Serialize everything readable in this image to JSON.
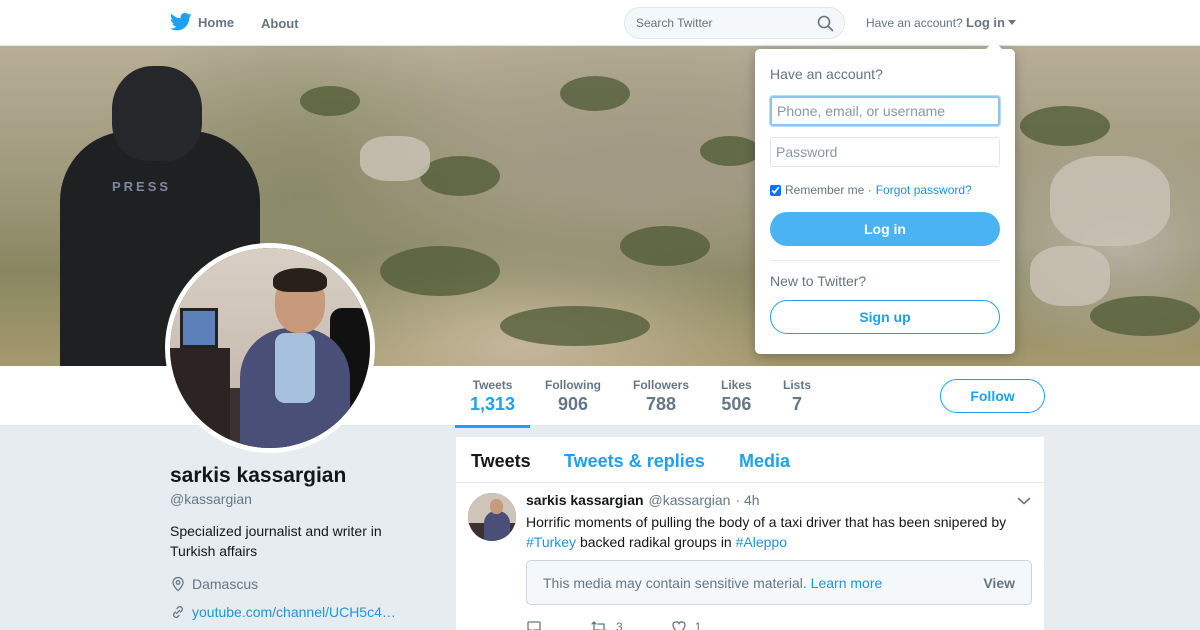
{
  "nav": {
    "home_label": "Home",
    "about_label": "About",
    "search_placeholder": "Search Twitter",
    "have_account": "Have an account?",
    "login_label": "Log in"
  },
  "banner": {
    "vest_text": "PRESS"
  },
  "stats": [
    {
      "label": "Tweets",
      "value": "1,313",
      "active": true
    },
    {
      "label": "Following",
      "value": "906"
    },
    {
      "label": "Followers",
      "value": "788"
    },
    {
      "label": "Likes",
      "value": "506"
    },
    {
      "label": "Lists",
      "value": "7"
    }
  ],
  "follow_label": "Follow",
  "profile": {
    "name": "sarkis kassargian",
    "handle": "@kassargian",
    "bio": "Specialized journalist and writer in Turkish affairs",
    "location": "Damascus",
    "url": "youtube.com/channel/UCH5c4…"
  },
  "timeline": {
    "tabs": [
      "Tweets",
      "Tweets & replies",
      "Media"
    ],
    "tweet": {
      "name": "sarkis kassargian",
      "handle": "@kassargian",
      "time": "· 4h",
      "text_1": "Horrific moments of pulling the body of a taxi driver that has been snipered by",
      "hashtag_1": "#Turkey",
      "text_2": "backed radikal groups in",
      "hashtag_2": "#Aleppo",
      "sensitive_msg": "This media may contain sensitive material.",
      "learn_more": "Learn more",
      "view": "View",
      "retweets": "3",
      "likes": "1"
    }
  },
  "login_dropdown": {
    "title": "Have an account?",
    "username_placeholder": "Phone, email, or username",
    "password_placeholder": "Password",
    "remember": "Remember me ·",
    "forgot": "Forgot password?",
    "login_button": "Log in",
    "new_to_twitter": "New to Twitter?",
    "signup_button": "Sign up"
  },
  "colors": {
    "accent": "#1da1f2",
    "link": "#1b95e0",
    "muted": "#657786",
    "background": "#e6ecf0"
  }
}
